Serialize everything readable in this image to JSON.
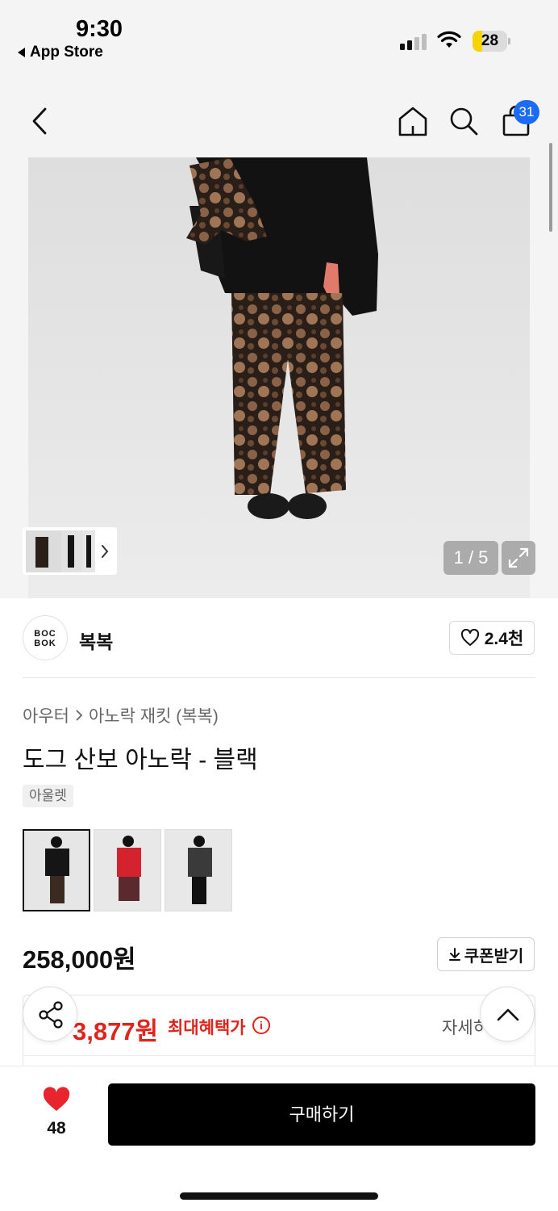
{
  "status_bar": {
    "time": "9:30",
    "back_app_label": "App Store",
    "battery_level": "28",
    "icons": [
      "signal-icon",
      "wifi-icon",
      "battery-icon"
    ]
  },
  "header": {
    "icons": [
      "back-chevron-icon",
      "home-icon",
      "search-icon",
      "shopping-bag-icon"
    ],
    "cart_badge": "31"
  },
  "gallery": {
    "counter": "1 / 5",
    "icons": [
      "chevron-right-icon",
      "expand-icon"
    ]
  },
  "brand": {
    "logo_line1": "BOC",
    "logo_line2": "BOK",
    "name": "복복",
    "likes": "2.4천"
  },
  "product": {
    "breadcrumb_category": "아우터",
    "breadcrumb_subcategory": "아노락 재킷 (복복)",
    "title": "도그 산보 아노락 - 블랙",
    "tag": "아울렛",
    "variant_colors": [
      "black",
      "red",
      "charcoal"
    ],
    "price": "258,000원",
    "coupon_label": "쿠폰받기"
  },
  "benefit": {
    "price": "3,877원",
    "label": "최대혜택가",
    "detail_label": "자세히"
  },
  "bottom_bar": {
    "wish_count": "48",
    "buy_label": "구매하기"
  },
  "colors": {
    "accent_red": "#e0241b",
    "badge_blue": "#1b6cf2",
    "buy_button": "#000000"
  }
}
